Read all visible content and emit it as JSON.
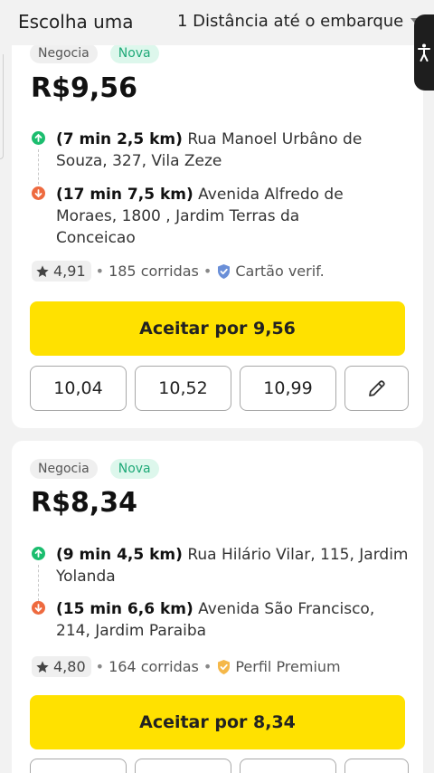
{
  "header": {
    "title": "Escolha uma",
    "sort_label": "1  Distância até o embarque"
  },
  "cards": [
    {
      "badge_negotiate": "Negocia",
      "badge_new": "Nova",
      "price": "R$9,56",
      "pickup_time": "(7 min 2,5 km)",
      "pickup_address_line1": "Rua Manoel Urbâno de",
      "pickup_address_line2": "Souza, 327, Vila Zeze",
      "dropoff_time": "(17 min 7,5 km)",
      "dropoff_address_line1": "Avenida Alfredo de",
      "dropoff_address_line2": "Moraes, 1800 , Jardim Terras da",
      "dropoff_address_line3": "Conceicao",
      "rating": "4,91",
      "rides": "185 corridas",
      "verification": "Cartão verif.",
      "accept_label": "Aceitar por 9,56",
      "offers": [
        "10,04",
        "10,52",
        "10,99"
      ]
    },
    {
      "badge_negotiate": "Negocia",
      "badge_new": "Nova",
      "price": "R$8,34",
      "pickup_time": "(9 min 4,5 km)",
      "pickup_address_line1": "Rua Hilário Vilar, 115, Jardim",
      "pickup_address_line2": "Yolanda",
      "dropoff_time": "(15 min 6,6 km)",
      "dropoff_address_line1": "Avenida São Francisco,",
      "dropoff_address_line2": "214, Jardim Paraiba",
      "rating": "4,80",
      "rides": "164 corridas",
      "verification": "Perfil Premium",
      "accept_label": "Aceitar por 8,34"
    }
  ],
  "colors": {
    "accent_yellow": "#ffe100",
    "pickup_green": "#1bbd6e",
    "dropoff_orange": "#ee6a3f",
    "verified_blue": "#6a8fd8",
    "premium_gold": "#f5b84a"
  },
  "icons": {
    "accessibility": "accessibility-icon",
    "star": "star-icon",
    "verified": "shield-check-icon",
    "edit": "pencil-icon"
  }
}
